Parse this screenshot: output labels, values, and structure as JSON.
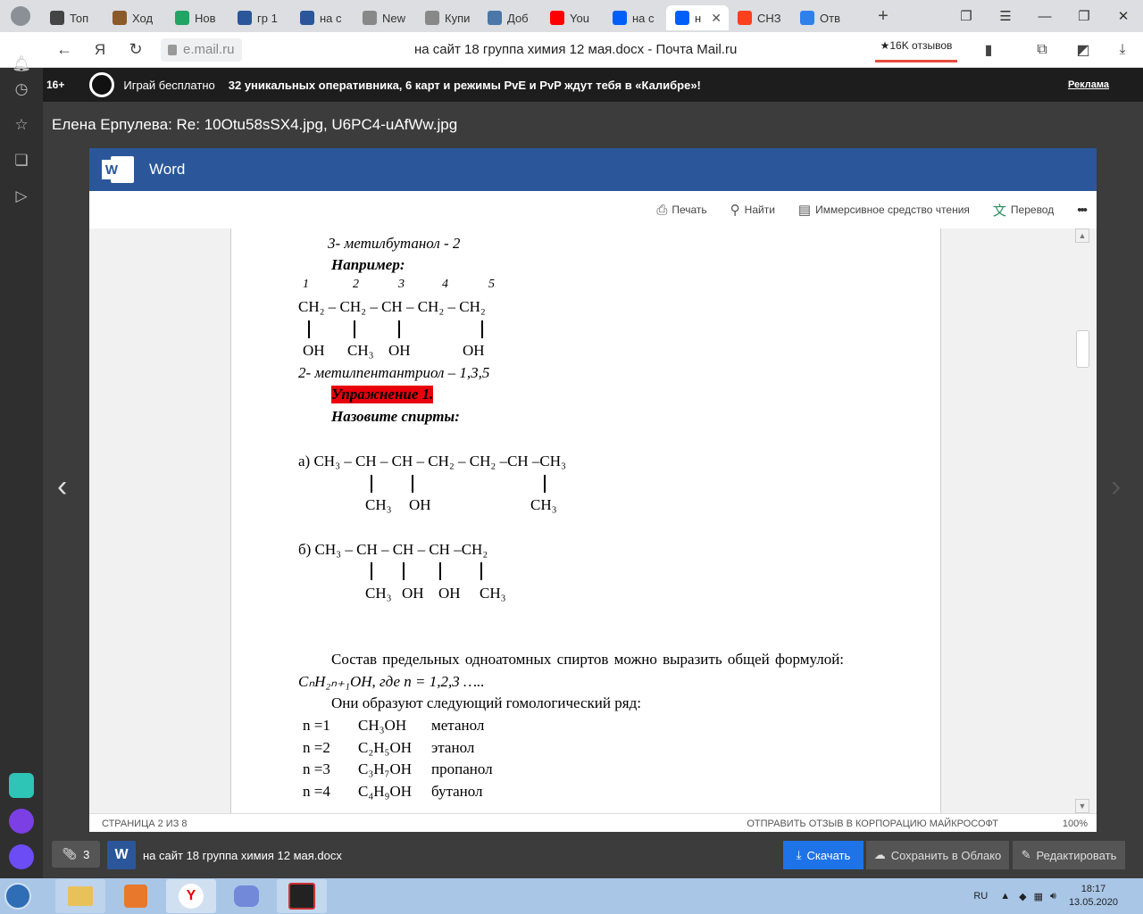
{
  "browser": {
    "tabs": [
      {
        "label": "Топ",
        "color": "#444"
      },
      {
        "label": "Ход",
        "color": "#8b5a2b"
      },
      {
        "label": "Нов",
        "color": "#21a464"
      },
      {
        "label": "гр 1",
        "color": "#2b579a"
      },
      {
        "label": "на с",
        "color": "#2b579a"
      },
      {
        "label": "New",
        "color": "#888"
      },
      {
        "label": "Купи",
        "color": "#888"
      },
      {
        "label": "Доб",
        "color": "#4a76a8"
      },
      {
        "label": "You",
        "color": "#ff0000"
      },
      {
        "label": "на с",
        "color": "#005ff9"
      },
      {
        "label": "н",
        "color": "#005ff9",
        "active": true
      },
      {
        "label": "СНЗ",
        "color": "#fc3f1d"
      },
      {
        "label": "Отв",
        "color": "#2f80ed"
      }
    ],
    "close_tab": "✕",
    "new_tab": "+",
    "url": "e.mail.ru",
    "page_title": "на сайт 18 группа химия 12 мая.docx - Почта Mail.ru",
    "reviews": "★16K отзывов"
  },
  "ad": {
    "age": "16+",
    "text1": "Играй бесплатно",
    "text2": "32 уникальных оперативника, 6 карт и режимы PvE и PvP ждут тебя в «Калибре»!",
    "link": "Реклама"
  },
  "mail": {
    "subject": "Елена Ерпулева: Re: 10Otu58sSX4.jpg, U6PC4-uAfWw.jpg"
  },
  "word": {
    "app_name": "Word",
    "logo_letter": "W",
    "toolbar": {
      "print": "Печать",
      "find": "Найти",
      "immersive": "Иммерсивное средство чтения",
      "translate": "Перевод",
      "more": "•••"
    },
    "status_left": "СТРАНИЦА 2 ИЗ 8",
    "status_right": "ОТПРАВИТЬ ОТЗЫВ В КОРПОРАЦИЮ МАЙКРОСОФТ",
    "zoom": "100%"
  },
  "doc": {
    "l1": "3- метилбутанол - 2",
    "l2": "Например:",
    "nums": [
      "1",
      "2",
      "3",
      "4",
      "5"
    ],
    "l3": "CH₂ – CH₂ – CH – CH₂ – CH₂",
    "oh1": "OH",
    "ch3a": "CH₃",
    "oh2": "OH",
    "oh3": "OH",
    "l4": "2- метилпентантриол – 1,3,5",
    "l5": "Упражнение 1.",
    "l6": "Назовите спирты:",
    "a": "а)  CH₃ – CH – CH – CH₂ – CH₂ –CH –CH₃",
    "a_ch3": "CH₃",
    "a_oh": "OH",
    "a_ch3b": "CH₃",
    "b": "б) CH₃ – CH – CH – CH –CH₂",
    "b_ch3": "CH₃",
    "b_oh1": "OH",
    "b_oh2": "OH",
    "b_ch3b": "CH₃",
    "p1": "Состав предельных одноатомных спиртов можно выразить общей формулой:",
    "p2": "CₙH₂ₙ₊₁OH,  где n = 1,2,3 …..",
    "p3": "Они образуют следующий гомологический ряд:",
    "rows": [
      {
        "n": "n =1",
        "f": "CH₃OH",
        "name": "метанол"
      },
      {
        "n": "n =2",
        "f": "C₂H₅OH",
        "name": "этанол"
      },
      {
        "n": "n =3",
        "f": "C₃H₇OH",
        "name": "пропанол"
      },
      {
        "n": "n =4",
        "f": "C₄H₉OH",
        "name": "бутанол"
      }
    ]
  },
  "footer": {
    "attachments": "3",
    "word_letter": "W",
    "filename": "на сайт 18 группа химия 12 мая.docx",
    "download": "Скачать",
    "save_cloud": "Сохранить в Облако",
    "edit": "Редактировать"
  },
  "taskbar": {
    "lang": "RU",
    "time": "18:17",
    "date": "13.05.2020"
  }
}
